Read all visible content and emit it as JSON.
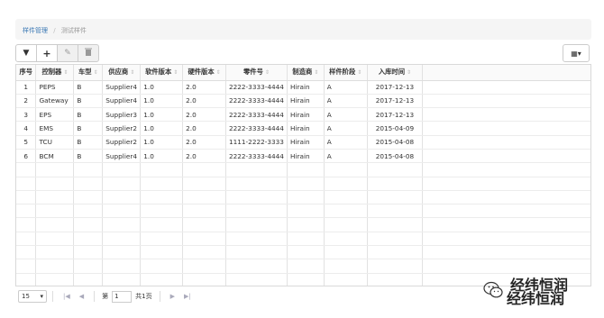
{
  "breadcrumb": {
    "parent": "样件管理",
    "current": "测试样件",
    "separator": "/"
  },
  "toolbar": {
    "buttons": [
      {
        "icon": "filter-icon",
        "glyph": "▼",
        "disabled": false
      },
      {
        "icon": "add-icon",
        "glyph": "+",
        "disabled": false
      },
      {
        "icon": "edit-icon",
        "glyph": "✎",
        "disabled": true
      },
      {
        "icon": "delete-icon",
        "glyph": "🗑",
        "disabled": true
      }
    ],
    "columns_glyph": "▦▾"
  },
  "table": {
    "columns": [
      "序号",
      "控制器",
      "车型",
      "供应商",
      "软件版本",
      "硬件版本",
      "零件号",
      "制造商",
      "样件阶段",
      "入库时间"
    ],
    "rows": [
      [
        "1",
        "PEPS",
        "B",
        "Supplier4",
        "1.0",
        "2.0",
        "2222-3333-4444",
        "Hirain",
        "A",
        "2017-12-13"
      ],
      [
        "2",
        "Gateway",
        "B",
        "Supplier4",
        "1.0",
        "2.0",
        "2222-3333-4444",
        "Hirain",
        "A",
        "2017-12-13"
      ],
      [
        "3",
        "EPS",
        "B",
        "Supplier3",
        "1.0",
        "2.0",
        "2222-3333-4444",
        "Hirain",
        "A",
        "2017-12-13"
      ],
      [
        "4",
        "EMS",
        "B",
        "Supplier2",
        "1.0",
        "2.0",
        "2222-3333-4444",
        "Hirain",
        "A",
        "2015-04-09"
      ],
      [
        "5",
        "TCU",
        "B",
        "Supplier2",
        "1.0",
        "2.0",
        "1111-2222-3333",
        "Hirain",
        "A",
        "2015-04-08"
      ],
      [
        "6",
        "BCM",
        "B",
        "Supplier4",
        "1.0",
        "2.0",
        "2222-3333-4444",
        "Hirain",
        "A",
        "2015-04-08"
      ]
    ]
  },
  "pager": {
    "page_size": "15",
    "page_prefix": "第",
    "current_page": "1",
    "total_pages_label": "共1页",
    "first": "|◀",
    "prev": "◀",
    "next": "▶",
    "last": "▶|"
  },
  "watermark": {
    "text": "经纬恒润"
  }
}
